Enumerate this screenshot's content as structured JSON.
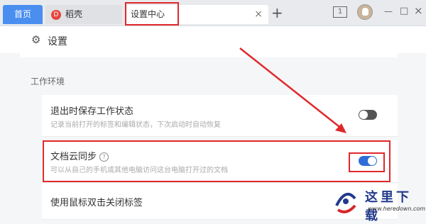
{
  "tabs": {
    "home_label": "首页",
    "daoke_label": "稻壳",
    "daoke_logo": "D",
    "settings_label": "设置中心",
    "close_glyph": "×",
    "new_tab_glyph": "+"
  },
  "titlebar": {
    "window_count": "1",
    "minimize_glyph": "—",
    "restore_glyph": "□",
    "close_glyph": "×"
  },
  "header": {
    "title": "设置",
    "gear_glyph": "⚙"
  },
  "section": {
    "title": "工作环境"
  },
  "settings": [
    {
      "title": "退出时保存工作状态",
      "desc": "记录当前打开的标签和编辑状态，下次启动时自动恢复",
      "enabled": false
    },
    {
      "title": "文档云同步",
      "help_glyph": "?",
      "desc": "可以从自己的手机或其他电脑访问这台电脑打开过的文档",
      "enabled": true
    },
    {
      "title": "使用鼠标双击关闭标签"
    }
  ],
  "watermark": {
    "text": "这里下载",
    "url": "www.heredown.com"
  },
  "colors": {
    "accent": "#4a8ff0",
    "toggle_on": "#2f6ed8",
    "annotation": "#e0282c",
    "watermark": "#223a8c"
  }
}
